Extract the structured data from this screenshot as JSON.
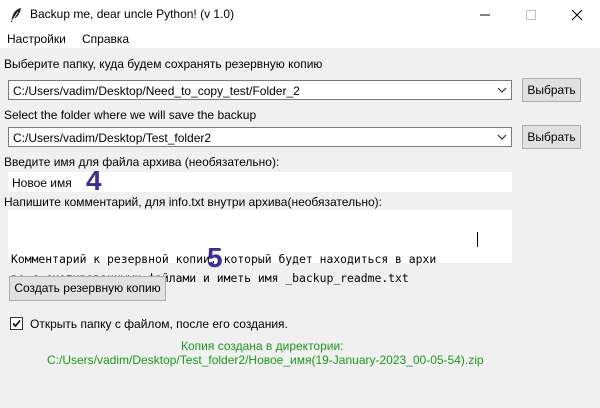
{
  "window": {
    "title": "Backup me, dear uncle Python! (v 1.0)",
    "icon": "feather-icon"
  },
  "menu": {
    "items": [
      "Настройки",
      "Справка"
    ]
  },
  "source": {
    "label": "Выберите папку, куда будем сохранять резервную копию",
    "path": "C:/Users/vadim/Desktop/Need_to_copy_test/Folder_2",
    "button": "Выбрать"
  },
  "target": {
    "label": "Select the folder where we will save the backup",
    "path": "C:/Users/vadim/Desktop/Test_folder2",
    "button": "Выбрать"
  },
  "archive_name": {
    "label": "Введите имя для файла архива (необязательно):",
    "value": "Новое имя",
    "annotation": "4"
  },
  "comment": {
    "label": "Напишите комментарий, для info.txt внутри архива(необязательно):",
    "lines": [
      "Комментарий к резервной копии, который будет находиться в архи",
      "ве с скопированными файлами и иметь имя _backup_readme.txt"
    ],
    "annotation": "5"
  },
  "create_button": "Создать резервную копию",
  "open_folder": {
    "checked": true,
    "label": "Открыть папку с файлом, после его создания."
  },
  "status": {
    "line1": "Копия создана в директории:",
    "line2": "C:/Users/vadim/Desktop/Test_folder2/Новое_имя(19-January-2023_00-05-54).zip",
    "color": "#1a9a1a"
  }
}
